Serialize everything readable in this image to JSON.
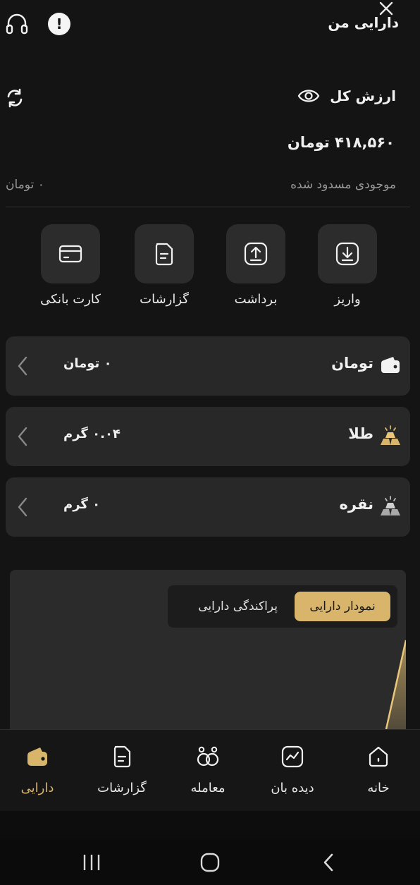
{
  "header": {
    "title": "دارایی من"
  },
  "summary": {
    "total_label": "ارزش کل",
    "total_value": "۴۱۸,۵۶۰ تومان",
    "blocked_label": "موجودی مسدود شده",
    "blocked_value": "۰ تومان"
  },
  "actions": [
    {
      "label": "واریز",
      "icon": "deposit-icon"
    },
    {
      "label": "برداشت",
      "icon": "withdraw-icon"
    },
    {
      "label": "گزارشات",
      "icon": "report-icon"
    },
    {
      "label": "کارت بانکی",
      "icon": "bank-card-icon"
    }
  ],
  "assets": [
    {
      "name": "تومان",
      "amount": "۰ تومان",
      "icon": "wallet-icon"
    },
    {
      "name": "طلا",
      "amount": "۰.۰۴ گرم",
      "icon": "gold-bars-icon",
      "color": "#d9b56b"
    },
    {
      "name": "نقره",
      "amount": "۰ گرم",
      "icon": "silver-bars-icon",
      "color": "#bdbdbd"
    }
  ],
  "chart_panel": {
    "tab_active": "نمودار دارایی",
    "tab_inactive": "پراکندگی دارایی"
  },
  "bottom_nav": [
    {
      "label": "خانه",
      "icon": "home-icon"
    },
    {
      "label": "دیده بان",
      "icon": "watchlist-icon"
    },
    {
      "label": "معامله",
      "icon": "trade-icon"
    },
    {
      "label": "گزارشات",
      "icon": "report-icon"
    },
    {
      "label": "دارایی",
      "icon": "wallet-icon",
      "active": true
    }
  ],
  "colors": {
    "accent": "#d9b56b",
    "background": "#141414",
    "card": "#282828"
  }
}
